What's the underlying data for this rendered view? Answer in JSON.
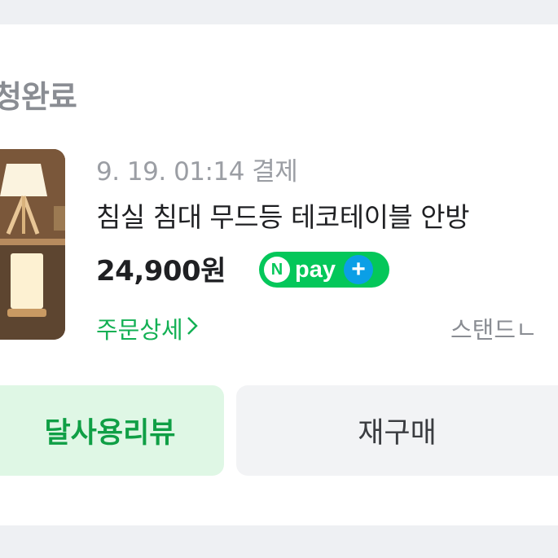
{
  "order": {
    "status": "청완료",
    "paid_at": "9. 19. 01:14 결제",
    "product_title": "침실 침대 무드등 테코테이블 안방",
    "price": "24,900원",
    "npay": {
      "badge_letter": "N",
      "word": "pay",
      "plus": "+"
    },
    "detail_link": "주문상세",
    "seller": "스탠드ㄴ"
  },
  "buttons": {
    "review": "달사용리뷰",
    "rebuy": "재구매"
  },
  "colors": {
    "npay_green": "#04c75a",
    "npay_plus_blue": "#0b9fe6",
    "link_green": "#13b054",
    "review_bg": "#dff7e5"
  }
}
